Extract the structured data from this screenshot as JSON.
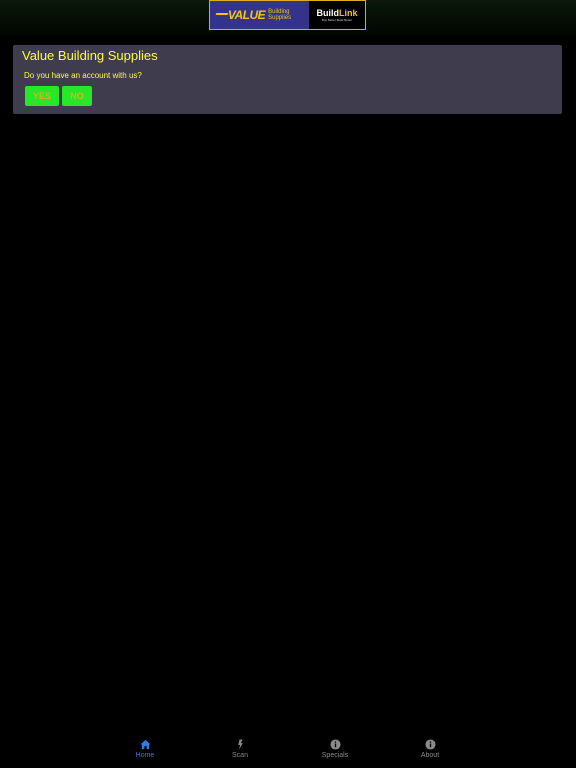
{
  "header": {
    "logo": {
      "brand": "VALUE",
      "brand_sub_1": "Building",
      "brand_sub_2": "Supplies",
      "partner_a": "Build",
      "partner_b": "Link",
      "partner_tagline": "Buy Better Build Better"
    }
  },
  "card": {
    "title": "Value Building Supplies",
    "question": "Do you have an account with us?",
    "yes_label": "YES",
    "no_label": "NO"
  },
  "tabbar": {
    "items": [
      {
        "label": "Home",
        "icon": "home-icon",
        "active": true
      },
      {
        "label": "Scan",
        "icon": "flash-icon",
        "active": false
      },
      {
        "label": "Specials",
        "icon": "info-icon",
        "active": false
      },
      {
        "label": "About",
        "icon": "info-icon",
        "active": false
      }
    ]
  },
  "colors": {
    "background": "#000000",
    "card": "#3f3c4d",
    "title_text": "#ffff33",
    "button_bg": "#28e628",
    "button_text": "#d9b21a",
    "tab_active": "#2f7de0",
    "tab_inactive": "#8a8a8a"
  }
}
